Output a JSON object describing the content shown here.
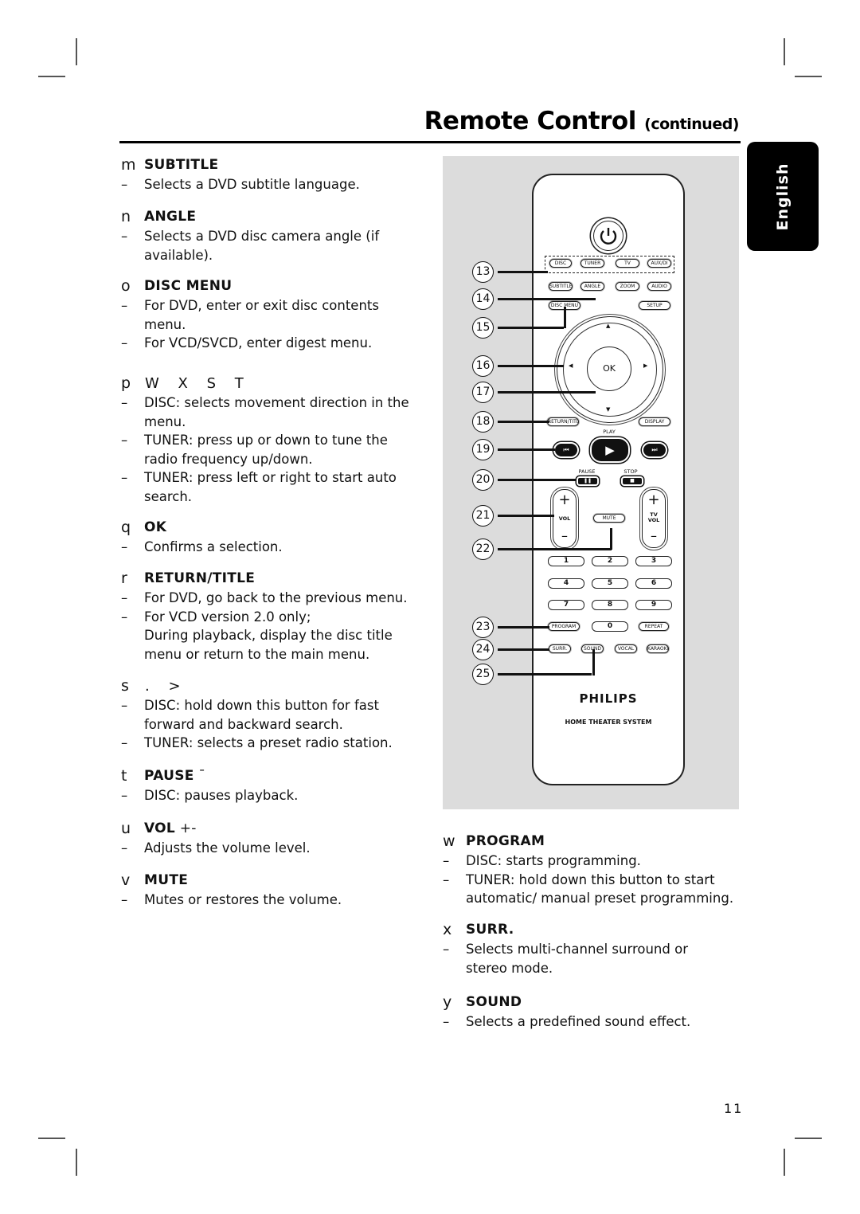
{
  "header": {
    "title": "Remote Control",
    "title_suffix": "(continued)"
  },
  "language_tab": "English",
  "left_sections": [
    {
      "letter": "m",
      "label": "SUBTITLE",
      "lines": [
        {
          "dash": true,
          "text": "Selects a DVD subtitle language."
        }
      ]
    },
    {
      "letter": "n",
      "label": "ANGLE",
      "lines": [
        {
          "dash": true,
          "text": "Selects a DVD disc camera angle (if"
        },
        {
          "dash": false,
          "text": "available)."
        }
      ]
    },
    {
      "letter": "o",
      "label": "DISC MENU",
      "lines": [
        {
          "dash": true,
          "text": "For DVD, enter or exit disc contents"
        },
        {
          "dash": false,
          "text": "menu."
        },
        {
          "dash": true,
          "text": "For VCD/SVCD, enter digest menu."
        }
      ]
    },
    {
      "letter": "p",
      "symbols": "W X S T",
      "lines": [
        {
          "dash": true,
          "text": "DISC: selects movement direction in the"
        },
        {
          "dash": false,
          "text": "menu."
        },
        {
          "dash": true,
          "text": "TUNER: press up or down to tune the"
        },
        {
          "dash": false,
          "text": "radio frequency up/down."
        },
        {
          "dash": true,
          "text": "TUNER: press left or right to start auto"
        },
        {
          "dash": false,
          "text": "search."
        }
      ]
    },
    {
      "letter": "q",
      "label": "OK",
      "lines": [
        {
          "dash": true,
          "text": "Confirms a selection."
        }
      ]
    },
    {
      "letter": "r",
      "label": "RETURN/TITLE",
      "lines": [
        {
          "dash": true,
          "text": "For DVD, go back to the previous menu."
        },
        {
          "dash": true,
          "text": "For VCD version 2.0 only;"
        },
        {
          "dash": false,
          "text": "During playback, display the disc title"
        },
        {
          "dash": false,
          "text": "menu or return to the main menu."
        }
      ]
    },
    {
      "letter": "s",
      "symbols": ".    >",
      "lines": [
        {
          "dash": true,
          "text": "DISC: hold down this button for fast"
        },
        {
          "dash": false,
          "text": "forward and backward search."
        },
        {
          "dash": true,
          "text": "TUNER:  selects a preset radio station."
        }
      ]
    },
    {
      "letter": "t",
      "label": "PAUSE",
      "label_suffix": " ¯",
      "lines": [
        {
          "dash": true,
          "text": "DISC: pauses playback."
        }
      ]
    },
    {
      "letter": "u",
      "label": "VOL",
      "label_suffix": " +-",
      "lines": [
        {
          "dash": true,
          "text": "Adjusts the volume level."
        }
      ]
    },
    {
      "letter": "v",
      "label": "MUTE",
      "lines": [
        {
          "dash": true,
          "text": "Mutes or restores the volume."
        }
      ]
    }
  ],
  "right_sections": [
    {
      "letter": "w",
      "label": "PROGRAM",
      "lines": [
        {
          "dash": true,
          "text": "DISC: starts programming."
        },
        {
          "dash": true,
          "text": "TUNER: hold down this button to start"
        },
        {
          "dash": false,
          "text": "automatic/ manual preset programming."
        }
      ]
    },
    {
      "letter": "x",
      "label": "SURR.",
      "lines": [
        {
          "dash": true,
          "text": "Selects multi-channel surround or"
        },
        {
          "dash": false,
          "text": "stereo mode."
        }
      ]
    },
    {
      "letter": "y",
      "label": "SOUND",
      "lines": [
        {
          "dash": true,
          "text": "Selects a predefined sound effect."
        }
      ]
    }
  ],
  "dash_char": "–",
  "remote": {
    "callouts": [
      "13",
      "14",
      "15",
      "16",
      "17",
      "18",
      "19",
      "20",
      "21",
      "22",
      "23",
      "24",
      "25"
    ],
    "source_buttons": [
      "DISC",
      "TUNER",
      "TV",
      "AUX/DI"
    ],
    "row2_buttons": [
      "SUBTITLE",
      "ANGLE",
      "ZOOM",
      "AUDIO"
    ],
    "disc_menu": "DISC MENU",
    "setup": "SETUP",
    "ok": "OK",
    "return_title": "RETURN/TITLE",
    "display": "DISPLAY",
    "play_label": "PLAY",
    "pause_label": "PAUSE",
    "stop_label": "STOP",
    "vol_label": "VOL",
    "mute_label": "MUTE",
    "tv_vol_label": "TV VOL",
    "plus": "+",
    "minus": "–",
    "numbers": [
      "1",
      "2",
      "3",
      "4",
      "5",
      "6",
      "7",
      "8",
      "9"
    ],
    "program": "PROGRAM",
    "zero": "0",
    "repeat": "REPEAT",
    "bottom_buttons": [
      "SURR.",
      "SOUND",
      "VOCAL",
      "KARAOKE"
    ],
    "brand": "PHILIPS",
    "subtitle": "HOME THEATER SYSTEM"
  },
  "page_number": "11"
}
